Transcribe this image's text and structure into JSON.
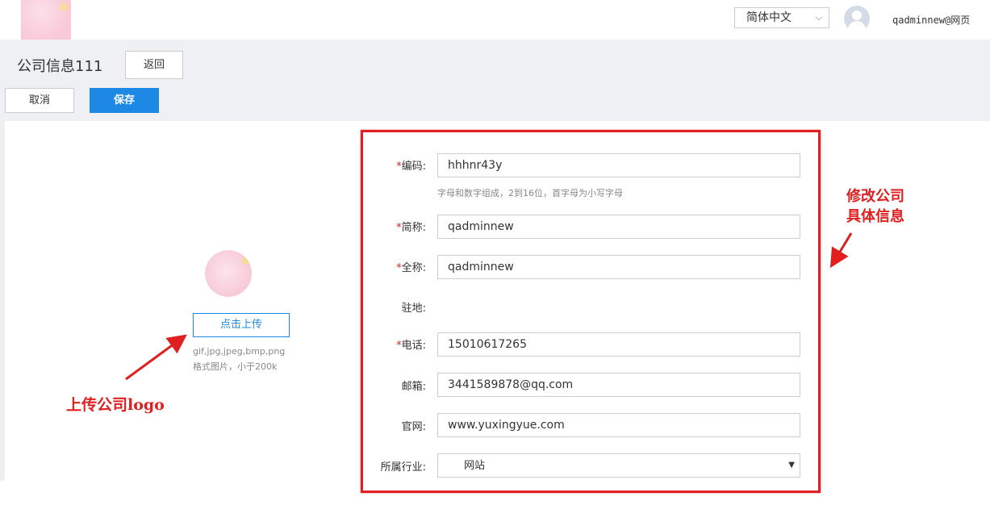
{
  "header": {
    "language": "简体中文",
    "username": "qadminnew@网页"
  },
  "toolbar": {
    "title": "公司信息111",
    "back_label": "返回",
    "cancel_label": "取消",
    "save_label": "保存"
  },
  "upload": {
    "button_label": "点击上传",
    "hint_formats": "gif,jpg,jpeg,bmp,png",
    "hint_size": "格式图片，小于200k"
  },
  "form": {
    "code_label": "编码:",
    "code_value": "hhhnr43y",
    "code_hint": "字母和数字组成，2到16位，首字母为小写字母",
    "short_name_label": "简称:",
    "short_name_value": "qadminnew",
    "full_name_label": "全称:",
    "full_name_value": "qadminnew",
    "location_label": "驻地:",
    "phone_label": "电话:",
    "phone_value": "15010617265",
    "email_label": "邮箱:",
    "email_value": "3441589878@qq.com",
    "website_label": "官网:",
    "website_value": "www.yuxingyue.com",
    "industry_label": "所属行业:",
    "industry_value": "网站"
  },
  "annotations": {
    "logo_note": "上传公司logo",
    "form_note_line1": "修改公司",
    "form_note_line2": "具体信息"
  },
  "colors": {
    "primary": "#1e88e5",
    "annotation_red": "#e02020",
    "header_gray": "#eef0f3"
  }
}
